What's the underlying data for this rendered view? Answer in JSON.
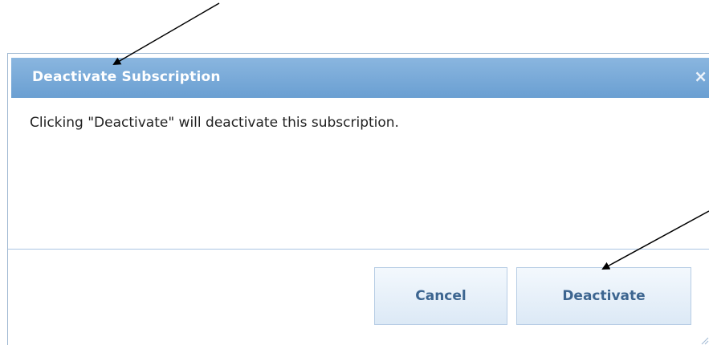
{
  "dialog": {
    "title": "Deactivate Subscription",
    "close_glyph": "×",
    "close_icon": "close-icon",
    "message": "Clicking \"Deactivate\" will deactivate this subscription.",
    "buttons": {
      "cancel_label": "Cancel",
      "deactivate_label": "Deactivate"
    },
    "resize_icon": "resize-grip-icon"
  },
  "annotations": {
    "arrow_color": "#000000",
    "arrow_count": 2
  },
  "colors": {
    "titlebar": "#7aaad9",
    "title_text": "#ffffff",
    "button_text": "#3c6590",
    "button_border": "#b7cde5",
    "divider": "#a9c5e3"
  }
}
